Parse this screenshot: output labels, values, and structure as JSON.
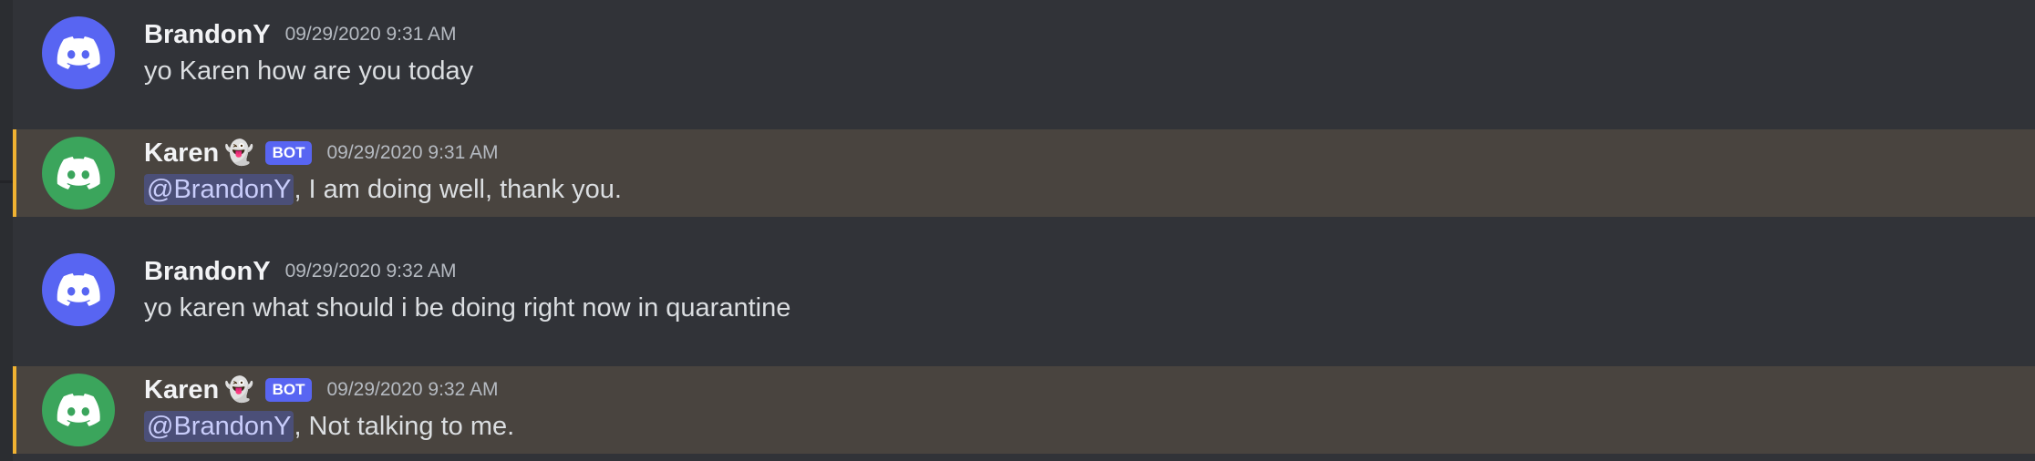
{
  "colors": {
    "background": "#313338",
    "highlight_background": "#49443f",
    "highlight_border": "#f0b232",
    "avatar_user": "#5865f2",
    "avatar_bot": "#3ba55c",
    "bot_tag": "#5865f2",
    "mention_bg": "#4b4f78"
  },
  "messages": [
    {
      "username": "BrandonY",
      "timestamp": "09/29/2020 9:31 AM",
      "text": "yo Karen how are you today",
      "avatar_icon": "discord-logo-icon"
    },
    {
      "username": "Karen",
      "username_emoji": "👻",
      "bot_tag": "BOT",
      "timestamp": "09/29/2020 9:31 AM",
      "mention": "@BrandonY",
      "text": ", I am doing well, thank you.",
      "avatar_icon": "discord-logo-icon"
    },
    {
      "username": "BrandonY",
      "timestamp": "09/29/2020 9:32 AM",
      "text": "yo karen what should i be doing right now in quarantine",
      "avatar_icon": "discord-logo-icon"
    },
    {
      "username": "Karen",
      "username_emoji": "👻",
      "bot_tag": "BOT",
      "timestamp": "09/29/2020 9:32 AM",
      "mention": "@BrandonY",
      "text": ", Not talking to me.",
      "avatar_icon": "discord-logo-icon"
    }
  ]
}
